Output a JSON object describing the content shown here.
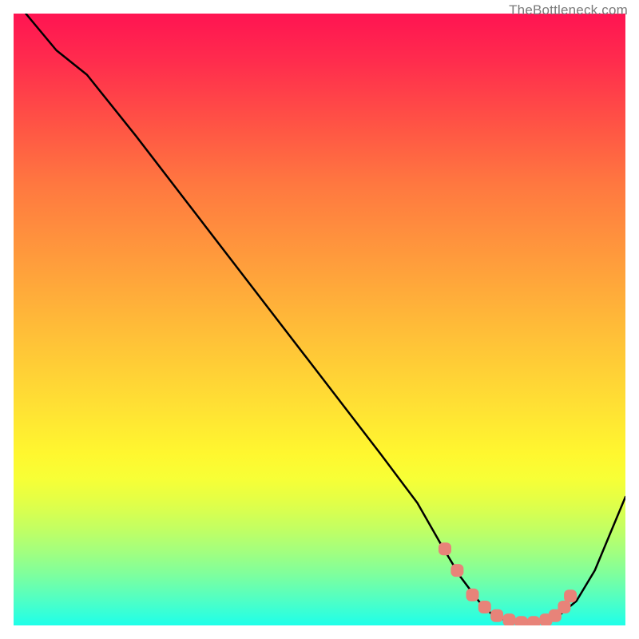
{
  "watermark": {
    "text": "TheBottleneck.com"
  },
  "chart_data": {
    "type": "line",
    "title": "",
    "xlabel": "",
    "ylabel": "",
    "xlim": [
      0,
      100
    ],
    "ylim": [
      0,
      100
    ],
    "series": [
      {
        "name": "curve",
        "x": [
          2,
          7,
          12,
          20,
          30,
          40,
          50,
          60,
          66,
          70,
          73,
          76,
          78,
          80,
          83,
          86,
          89,
          92,
          95,
          100
        ],
        "values": [
          100,
          94,
          90,
          80,
          67,
          54,
          41,
          28,
          20,
          13,
          8,
          4,
          2,
          1,
          0.5,
          0.5,
          1.5,
          4,
          9,
          21
        ]
      }
    ],
    "markers": {
      "name": "dots",
      "x": [
        70.5,
        72.5,
        75,
        77,
        79,
        81,
        83,
        85,
        87,
        88.5,
        90,
        91
      ],
      "values": [
        12.5,
        9,
        5,
        3,
        1.6,
        0.9,
        0.5,
        0.5,
        0.9,
        1.6,
        3,
        4.8
      ],
      "color": "#e88379"
    },
    "colors": {
      "gradient_top": "#ff1452",
      "gradient_mid": "#ffe034",
      "gradient_bottom": "#1fffe9",
      "line": "#000000",
      "marker": "#e88379"
    }
  }
}
